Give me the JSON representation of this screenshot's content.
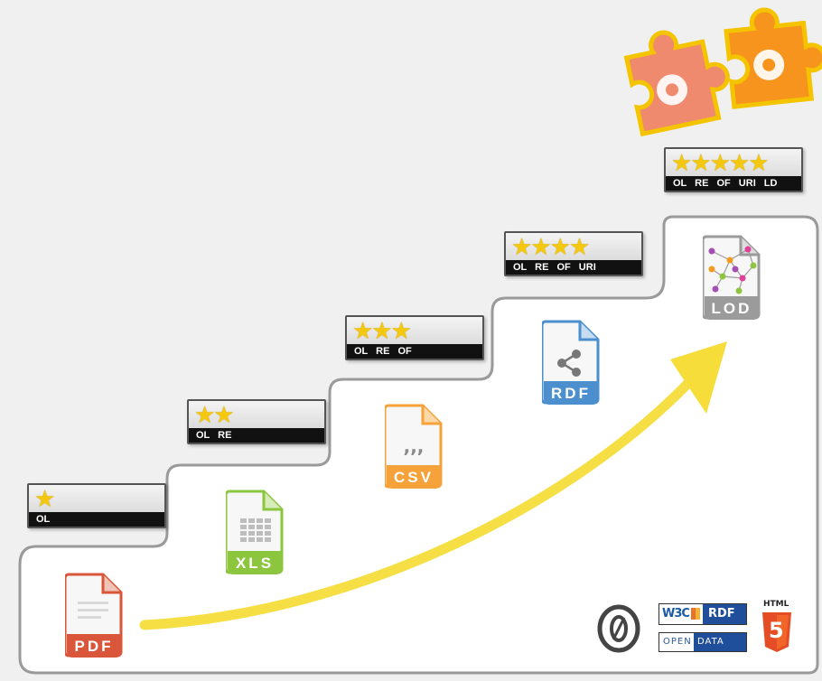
{
  "ratings": [
    {
      "stars": "★",
      "labels": "OL"
    },
    {
      "stars": "★★",
      "labels": "OL RE"
    },
    {
      "stars": "★★★",
      "labels": "OL RE OF"
    },
    {
      "stars": "★★★★",
      "labels": "OL RE OF URI"
    },
    {
      "stars": "★★★★★",
      "labels": "OL RE OF URI LD"
    }
  ],
  "formats": {
    "pdf": "PDF",
    "xls": "XLS",
    "csv": "CSV",
    "rdf": "RDF",
    "lod": "LOD"
  },
  "logos": {
    "w3c": "W3C",
    "rdf": "RDF",
    "open": "OPEN",
    "data": "DATA",
    "html": "HTML",
    "html5": "5"
  },
  "colors": {
    "pdf": "#d9563a",
    "xls": "#8cc63f",
    "csv": "#f6a23a",
    "rdf": "#4b8fce",
    "lod": "#9b9b9b",
    "arrow": "#f6dd3a",
    "star": "#f3c80f",
    "puzzle_left": "#f08a6e",
    "puzzle_right": "#f7941d"
  }
}
